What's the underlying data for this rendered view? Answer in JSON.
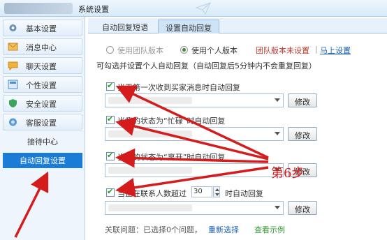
{
  "window": {
    "title": "系统设置"
  },
  "sidebar": {
    "items": [
      {
        "label": "基本设置",
        "icon": "gear-icon",
        "color": "#6a8fb5"
      },
      {
        "label": "消息中心",
        "icon": "envelope-icon",
        "color": "#e8a53b"
      },
      {
        "label": "聊天设置",
        "icon": "chat-bubble-icon",
        "color": "#f0b23a"
      },
      {
        "label": "个性设置",
        "icon": "personalize-icon",
        "color": "#4a8fd0"
      },
      {
        "label": "安全设置",
        "icon": "shield-icon",
        "color": "#3aa55a"
      },
      {
        "label": "客服设置",
        "icon": "headset-icon",
        "color": "#5b9bd5"
      }
    ],
    "sub_items": [
      {
        "label": "接待中心",
        "active": false
      },
      {
        "label": "自动回复设置",
        "active": true
      }
    ]
  },
  "tabs": [
    {
      "label": "自动回复短语",
      "active": false
    },
    {
      "label": "设置自动回复",
      "active": true
    }
  ],
  "version": {
    "team_label": "使用团队版本",
    "personal_label": "使用个人版本",
    "selected": "personal",
    "team_notice": "团队版本未设置",
    "setup_link": "马上设置"
  },
  "hint": "可勾选并设置个人自动回复（自动回复后5分钟内不会重复回复）",
  "options": [
    {
      "label": "当天第一次收到买家消息时自动回复",
      "checked": true,
      "button": "修改"
    },
    {
      "label": "当我的状态为“忙碌”时自动回复",
      "checked": true,
      "button": "修改"
    },
    {
      "label": "当我的状态为“离开”时自动回复",
      "checked": true,
      "button": "修改"
    },
    {
      "label_before": "当正在联系人数超过",
      "count": "30",
      "label_after": "时自动回复",
      "checked": true,
      "button": "修改"
    }
  ],
  "footer": {
    "related": "关联问题：已选择0个问题，",
    "reselect": "重新选择",
    "view_example": "查看示例"
  },
  "annotation": {
    "step_label": "第6步",
    "color": "#d41c1c"
  }
}
